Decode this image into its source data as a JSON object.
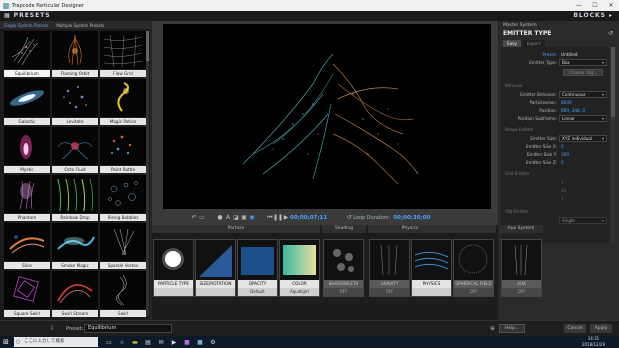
{
  "window": {
    "title": "Trapcode Particular Designer"
  },
  "header": {
    "presets": "PRESETS",
    "blocks": "BLOCKS"
  },
  "preset_tabs": [
    "Single System Presets",
    "Multiple System Presets"
  ],
  "presets": [
    "Equilibrium",
    "Flaming Orbit",
    "Flow Grid",
    "Galactic",
    "Levitate",
    "Magic Potion",
    "Mystic",
    "Octo Fluid",
    "Paint Rattle",
    "Phantom",
    "Rainbow Drop",
    "Rising Bubbles",
    "Slice",
    "Smoke Magic",
    "Sparkle Vortex",
    "Square Swirl",
    "Swirl Stream",
    "Swirl"
  ],
  "transport": {
    "current_time": "00;00;07;11",
    "loop_label": "Loop Duration:",
    "loop_time": "00;00;30;00"
  },
  "block_headers": {
    "particle": "Particle",
    "shading": "Shading",
    "physics": "Physics",
    "aux": "Aux System"
  },
  "blocks": [
    {
      "label": "PARTICLE TYPE",
      "sub": ""
    },
    {
      "label": "SIZE/ROTATION",
      "sub": ""
    },
    {
      "label": "OPACITY",
      "sub": "Default"
    },
    {
      "label": "COLOR",
      "sub": "Aqualight"
    },
    {
      "label": "SHADOWLETS",
      "sub": "OFF"
    },
    {
      "label": "GRAVITY",
      "sub": "OFF"
    },
    {
      "label": "PHYSICS",
      "sub": ""
    },
    {
      "label": "SPHERICAL FIELD",
      "sub": "OFF"
    },
    {
      "label": "AUX",
      "sub": "OFF"
    }
  ],
  "right_panel": {
    "system": "Master System",
    "title": "EMITTER TYPE",
    "tabs": [
      "Easy",
      "Expert"
    ],
    "preset_label": "Preset:",
    "preset_value": "Untitled",
    "emitter_type_label": "Emitter Type:",
    "emitter_type_value": "Box",
    "choose_obj": "Choose OBJ...",
    "behavior_section": "Behavior",
    "emitter_behavior_label": "Emitter Behavior:",
    "emitter_behavior_value": "Continuous",
    "particles_sec_label": "Particles/sec:",
    "particles_sec_value": "8000",
    "position_label": "Position:",
    "position_value": "660, 348, 0",
    "position_subframe_label": "Position Subframe:",
    "position_subframe_value": "Linear",
    "shape_section": "Shape Emitter",
    "emitter_size_label": "Emitter Size:",
    "emitter_size_value": "XYZ Individual",
    "size_x_label": "Emitter Size X:",
    "size_x_value": "0",
    "size_y_label": "Emitter Size Y:",
    "size_y_value": "300",
    "size_z_label": "Emitter Size Z:",
    "size_z_value": "0",
    "grid_section": "Grid Emitter",
    "grid_v1": "1",
    "grid_v2": "42",
    "grid_v3": "1",
    "obj_section": "OBJ Emitter",
    "obj_value": "Single"
  },
  "bottom": {
    "preset_label": "Preset:",
    "preset_value": "Equilibrium",
    "help": "Help...",
    "cancel": "Cancel",
    "apply": "Apply"
  },
  "taskbar": {
    "search": "ここに入力して検索",
    "time": "14:31",
    "date": "2018/12/29"
  }
}
